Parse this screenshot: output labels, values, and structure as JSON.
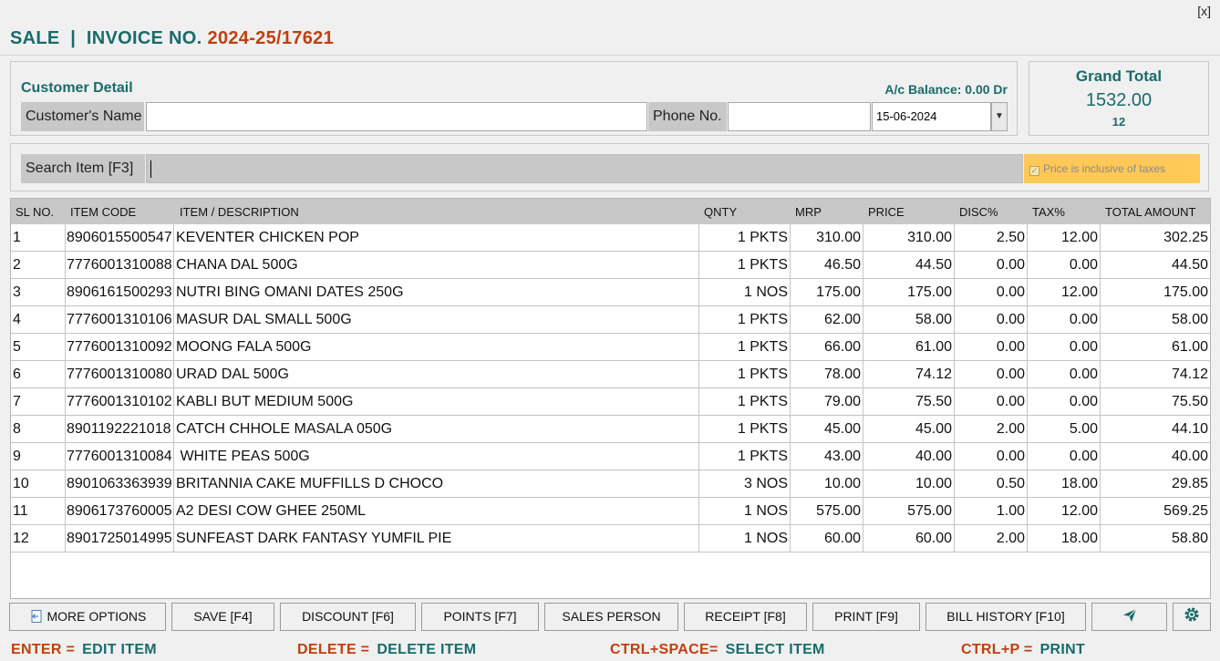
{
  "window": {
    "close_label": "[x]"
  },
  "header": {
    "title": "SALE  |  INVOICE NO.",
    "invoice_no": "2024-25/17621"
  },
  "customer": {
    "section_title": "Customer Detail",
    "balance": "A/c Balance: 0.00 Dr",
    "name_label": "Customer's Name",
    "name_value": "",
    "phone_label": "Phone No.",
    "phone_value": "",
    "date_value": "15-06-2024"
  },
  "grand_total": {
    "label": "Grand Total",
    "value": "1532.00",
    "count": "12"
  },
  "search": {
    "label": "Search Item [F3]",
    "value": "",
    "price_inclusive_label": "Price is inclusive of taxes",
    "price_inclusive_checked": true
  },
  "table": {
    "columns": [
      "SL NO.",
      "ITEM CODE",
      "ITEM / DESCRIPTION",
      "QNTY",
      "MRP",
      "PRICE",
      "DISC%",
      "TAX%",
      "TOTAL AMOUNT"
    ],
    "rows": [
      [
        "1",
        "8906015500547",
        "KEVENTER CHICKEN POP",
        "1 PKTS",
        "310.00",
        "310.00",
        "2.50",
        "12.00",
        "302.25"
      ],
      [
        "2",
        "7776001310088",
        "CHANA DAL 500G",
        "1 PKTS",
        "46.50",
        "44.50",
        "0.00",
        "0.00",
        "44.50"
      ],
      [
        "3",
        "8906161500293",
        "NUTRI BING OMANI DATES 250G",
        "1 NOS",
        "175.00",
        "175.00",
        "0.00",
        "12.00",
        "175.00"
      ],
      [
        "4",
        "7776001310106",
        "MASUR DAL SMALL 500G",
        "1 PKTS",
        "62.00",
        "58.00",
        "0.00",
        "0.00",
        "58.00"
      ],
      [
        "5",
        "7776001310092",
        "MOONG FALA 500G",
        "1 PKTS",
        "66.00",
        "61.00",
        "0.00",
        "0.00",
        "61.00"
      ],
      [
        "6",
        "7776001310080",
        "URAD DAL 500G",
        "1 PKTS",
        "78.00",
        "74.12",
        "0.00",
        "0.00",
        "74.12"
      ],
      [
        "7",
        "7776001310102",
        "KABLI BUT MEDIUM 500G",
        "1 PKTS",
        "79.00",
        "75.50",
        "0.00",
        "0.00",
        "75.50"
      ],
      [
        "8",
        "8901192221018",
        "CATCH CHHOLE MASALA 050G",
        "1 PKTS",
        "45.00",
        "45.00",
        "2.00",
        "5.00",
        "44.10"
      ],
      [
        "9",
        "7776001310084",
        " WHITE PEAS 500G",
        "1 PKTS",
        "43.00",
        "40.00",
        "0.00",
        "0.00",
        "40.00"
      ],
      [
        "10",
        "8901063363939",
        "BRITANNIA CAKE MUFFILLS D CHOCO",
        "3 NOS",
        "10.00",
        "10.00",
        "0.50",
        "18.00",
        "29.85"
      ],
      [
        "11",
        "8906173760005",
        "A2 DESI COW GHEE 250ML",
        "1 NOS",
        "575.00",
        "575.00",
        "1.00",
        "12.00",
        "569.25"
      ],
      [
        "12",
        "8901725014995",
        "SUNFEAST DARK FANTASY YUMFIL PIE",
        "1 NOS",
        "60.00",
        "60.00",
        "2.00",
        "18.00",
        "58.80"
      ]
    ]
  },
  "buttons": {
    "more_options": "MORE OPTIONS",
    "save": "SAVE [F4]",
    "discount": "DISCOUNT [F6]",
    "points": "POINTS [F7]",
    "sales_person": "SALES PERSON",
    "receipt": "RECEIPT [F8]",
    "print": "PRINT [F9]",
    "bill_history": "BILL HISTORY [F10]",
    "send_icon": "send-icon",
    "settings_icon": "gear-icon"
  },
  "shortcuts": [
    {
      "key": "ENTER =",
      "action": "EDIT ITEM"
    },
    {
      "key": "DELETE =",
      "action": "DELETE ITEM"
    },
    {
      "key": "CTRL+SPACE=",
      "action": "SELECT ITEM"
    },
    {
      "key": "CTRL+P =",
      "action": "PRINT"
    }
  ],
  "colors": {
    "accent": "#1a6b6b",
    "invoice": "#c0400e",
    "header_bg": "#c8c8c8",
    "price_incl_bg": "#ffc857"
  }
}
